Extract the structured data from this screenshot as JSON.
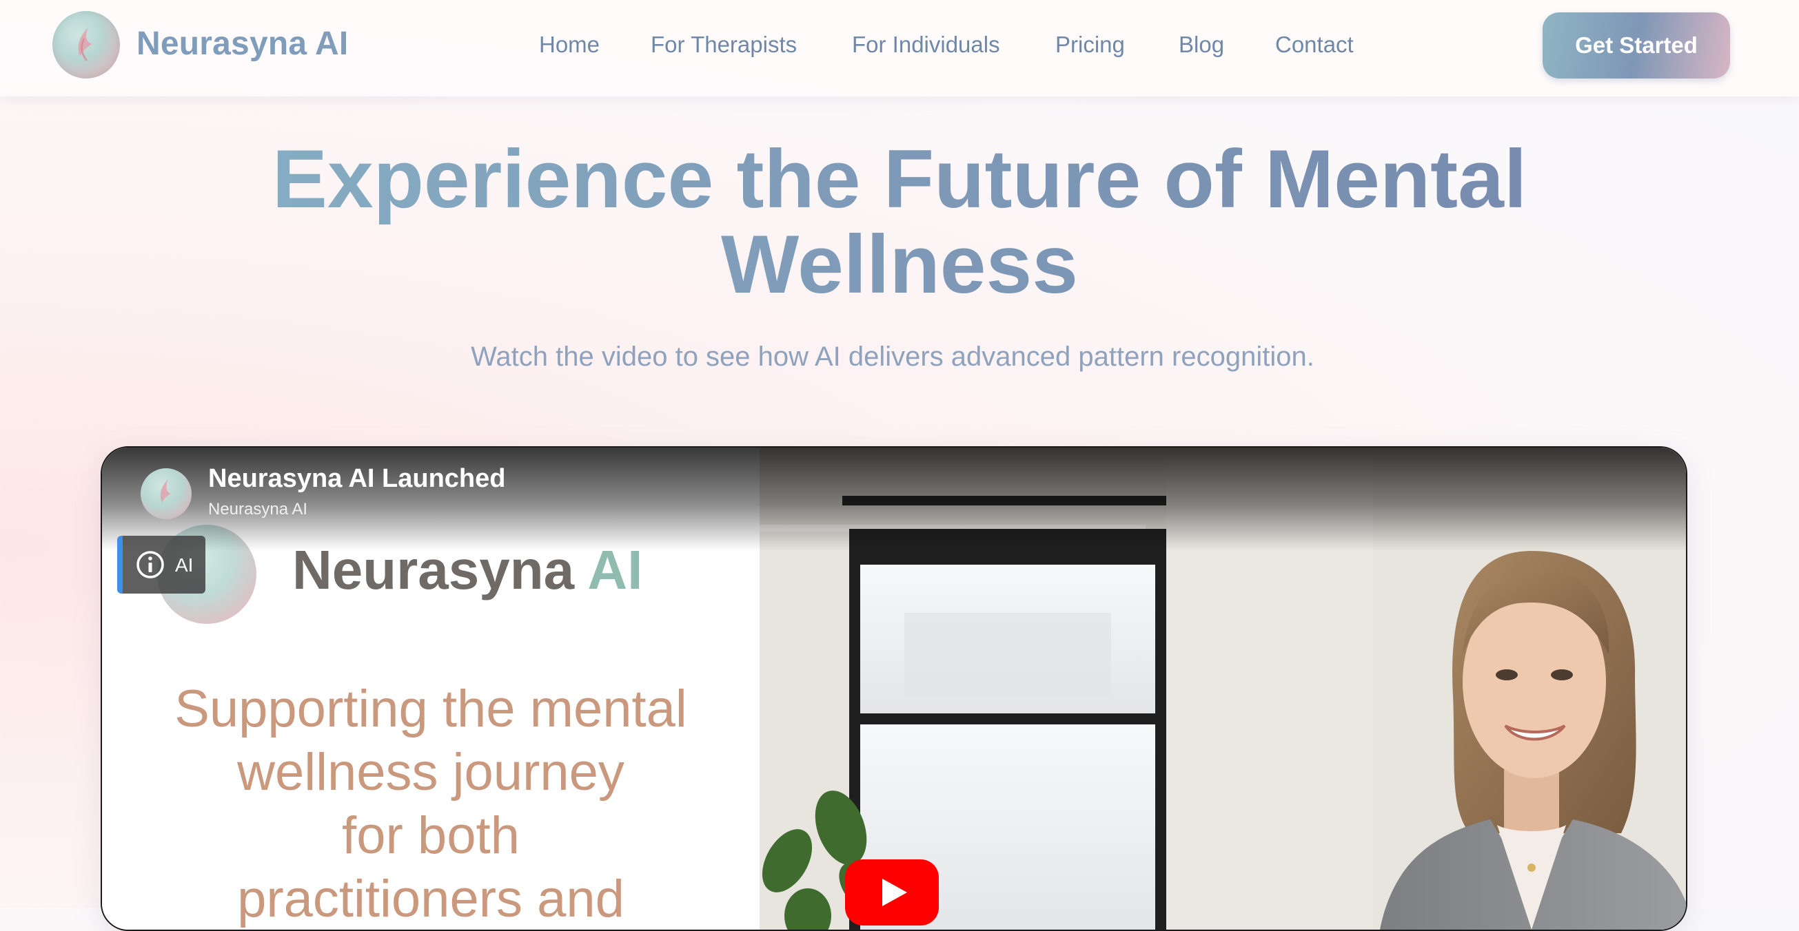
{
  "brand": {
    "name": "Neurasyna AI",
    "logo_icon": "brand-logo-icon"
  },
  "nav": {
    "links": [
      "Home",
      "For Therapists",
      "For Individuals",
      "Pricing",
      "Blog",
      "Contact"
    ],
    "cta_label": "Get Started"
  },
  "hero": {
    "title_line1": "Experience the Future of Mental",
    "title_line2": "Wellness",
    "subtitle": "Watch the video to see how AI delivers advanced pattern recognition."
  },
  "video": {
    "title": "Neurasyna AI Launched",
    "channel": "Neurasyna AI",
    "badge_label": "AI",
    "badge_icon": "info-icon",
    "play_icon": "play-icon",
    "slide": {
      "brand_main": "Neurasyna",
      "brand_accent": "AI",
      "text_lines": [
        "Supporting the mental",
        "wellness journey",
        "for both",
        "practitioners and"
      ]
    }
  },
  "colors": {
    "brand": "#7f9dbb",
    "nav_text": "#7088a8",
    "cta_gradient": [
      "#8fb5c4",
      "#7f97b6",
      "#d8b6c4"
    ],
    "play_red": "#ff0000",
    "badge_accent": "#3f8fe6",
    "slide_text": "#c9987d",
    "slide_accent": "#8fbcae"
  }
}
